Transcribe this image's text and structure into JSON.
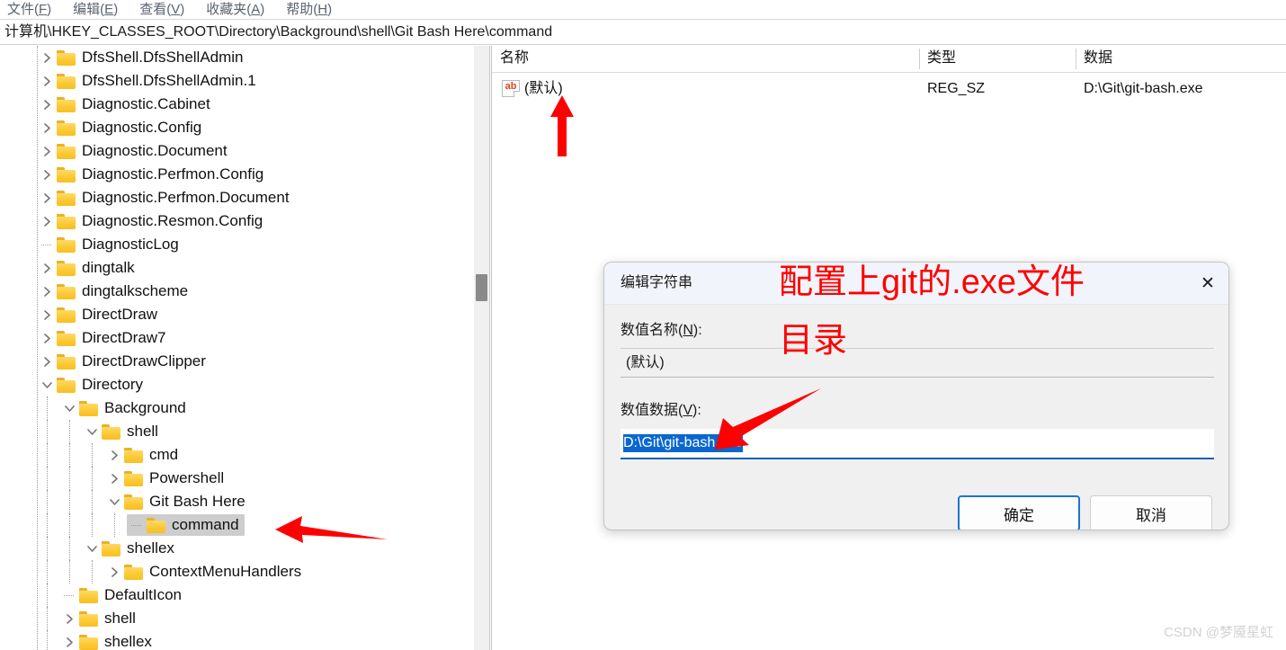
{
  "menu": {
    "items": [
      {
        "label": "文件(F)",
        "accel": "F",
        "pre": "文件(",
        "post": ")"
      },
      {
        "label": "编辑(E)",
        "accel": "E",
        "pre": "编辑(",
        "post": ")"
      },
      {
        "label": "查看(V)",
        "accel": "V",
        "pre": "查看(",
        "post": ")"
      },
      {
        "label": "收藏夹(A)",
        "accel": "A",
        "pre": "收藏夹(",
        "post": ")"
      },
      {
        "label": "帮助(H)",
        "accel": "H",
        "pre": "帮助(",
        "post": ")"
      }
    ]
  },
  "address": {
    "path": "计算机\\HKEY_CLASSES_ROOT\\Directory\\Background\\shell\\Git Bash Here\\command"
  },
  "tree": {
    "nodes": [
      {
        "label": "DfsShell.DfsShellAdmin",
        "depth": 1,
        "state": "collapsed",
        "selected": false
      },
      {
        "label": "DfsShell.DfsShellAdmin.1",
        "depth": 1,
        "state": "collapsed",
        "selected": false
      },
      {
        "label": "Diagnostic.Cabinet",
        "depth": 1,
        "state": "collapsed",
        "selected": false
      },
      {
        "label": "Diagnostic.Config",
        "depth": 1,
        "state": "collapsed",
        "selected": false
      },
      {
        "label": "Diagnostic.Document",
        "depth": 1,
        "state": "collapsed",
        "selected": false
      },
      {
        "label": "Diagnostic.Perfmon.Config",
        "depth": 1,
        "state": "collapsed",
        "selected": false
      },
      {
        "label": "Diagnostic.Perfmon.Document",
        "depth": 1,
        "state": "collapsed",
        "selected": false
      },
      {
        "label": "Diagnostic.Resmon.Config",
        "depth": 1,
        "state": "collapsed",
        "selected": false
      },
      {
        "label": "DiagnosticLog",
        "depth": 1,
        "state": "leaf",
        "selected": false
      },
      {
        "label": "dingtalk",
        "depth": 1,
        "state": "collapsed",
        "selected": false
      },
      {
        "label": "dingtalkscheme",
        "depth": 1,
        "state": "collapsed",
        "selected": false
      },
      {
        "label": "DirectDraw",
        "depth": 1,
        "state": "collapsed",
        "selected": false
      },
      {
        "label": "DirectDraw7",
        "depth": 1,
        "state": "collapsed",
        "selected": false
      },
      {
        "label": "DirectDrawClipper",
        "depth": 1,
        "state": "collapsed",
        "selected": false
      },
      {
        "label": "Directory",
        "depth": 1,
        "state": "expanded",
        "selected": false
      },
      {
        "label": "Background",
        "depth": 2,
        "state": "expanded",
        "selected": false
      },
      {
        "label": "shell",
        "depth": 3,
        "state": "expanded",
        "selected": false
      },
      {
        "label": "cmd",
        "depth": 4,
        "state": "collapsed",
        "selected": false
      },
      {
        "label": "Powershell",
        "depth": 4,
        "state": "collapsed",
        "selected": false
      },
      {
        "label": "Git Bash Here",
        "depth": 4,
        "state": "expanded",
        "selected": false
      },
      {
        "label": "command",
        "depth": 5,
        "state": "leaf",
        "selected": true
      },
      {
        "label": "shellex",
        "depth": 3,
        "state": "expanded",
        "selected": false
      },
      {
        "label": "ContextMenuHandlers",
        "depth": 4,
        "state": "collapsed",
        "selected": false
      },
      {
        "label": "DefaultIcon",
        "depth": 2,
        "state": "leaf",
        "selected": false
      },
      {
        "label": "shell",
        "depth": 2,
        "state": "collapsed",
        "selected": false
      },
      {
        "label": "shellex",
        "depth": 2,
        "state": "collapsed",
        "selected": false
      }
    ]
  },
  "list": {
    "columns": [
      {
        "label": "名称"
      },
      {
        "label": "类型"
      },
      {
        "label": "数据"
      }
    ],
    "rows": [
      {
        "icon": "string-value-icon",
        "name": "(默认)",
        "type": "REG_SZ",
        "data": "D:\\Git\\git-bash.exe"
      }
    ]
  },
  "dialog": {
    "title": "编辑字符串",
    "close_glyph": "✕",
    "name_label_pre": "数值名称(",
    "name_label_accel": "N",
    "name_label_post": "):",
    "name_value": "(默认)",
    "data_label_pre": "数值数据(",
    "data_label_accel": "V",
    "data_label_post": "):",
    "data_value": "D:\\Git\\git-bash.exe",
    "ok_label": "确定",
    "cancel_label": "取消"
  },
  "annotations": {
    "note_line1": "配置上git的.exe文件",
    "note_line2": "目录",
    "color": "#ff0000"
  },
  "watermark": {
    "text": "CSDN @梦魇星虹"
  }
}
